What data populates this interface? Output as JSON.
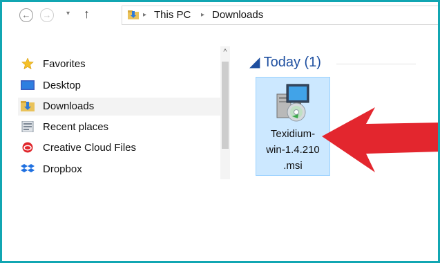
{
  "window": {
    "accent_color": "#11a6b2"
  },
  "navigation": {
    "back_icon": "back-arrow-icon",
    "forward_icon": "forward-arrow-icon",
    "dropdown_icon": "chevron-down-icon",
    "up_icon": "up-arrow-icon",
    "back_glyph": "←",
    "forward_glyph": "→",
    "dropdown_glyph": "▾",
    "up_glyph": "↑"
  },
  "address_bar": {
    "separator": "▸",
    "breadcrumbs": [
      "This PC",
      "Downloads"
    ]
  },
  "nav_pane": {
    "items": [
      {
        "label": "Favorites",
        "icon": "star-icon"
      },
      {
        "label": "Desktop",
        "icon": "desktop-icon"
      },
      {
        "label": "Downloads",
        "icon": "downloads-folder-icon",
        "selected": true
      },
      {
        "label": "Recent places",
        "icon": "recent-places-icon"
      },
      {
        "label": "Creative Cloud Files",
        "icon": "creative-cloud-icon"
      },
      {
        "label": "Dropbox",
        "icon": "dropbox-icon"
      }
    ],
    "scroll_up_glyph": "^"
  },
  "content": {
    "group_label": "◢ Today (1)",
    "file": {
      "name_lines": [
        "Texidium-",
        "win-1.4.210",
        ".msi"
      ],
      "icon": "msi-installer-icon"
    },
    "annotation_arrow_color": "#e3262e"
  }
}
